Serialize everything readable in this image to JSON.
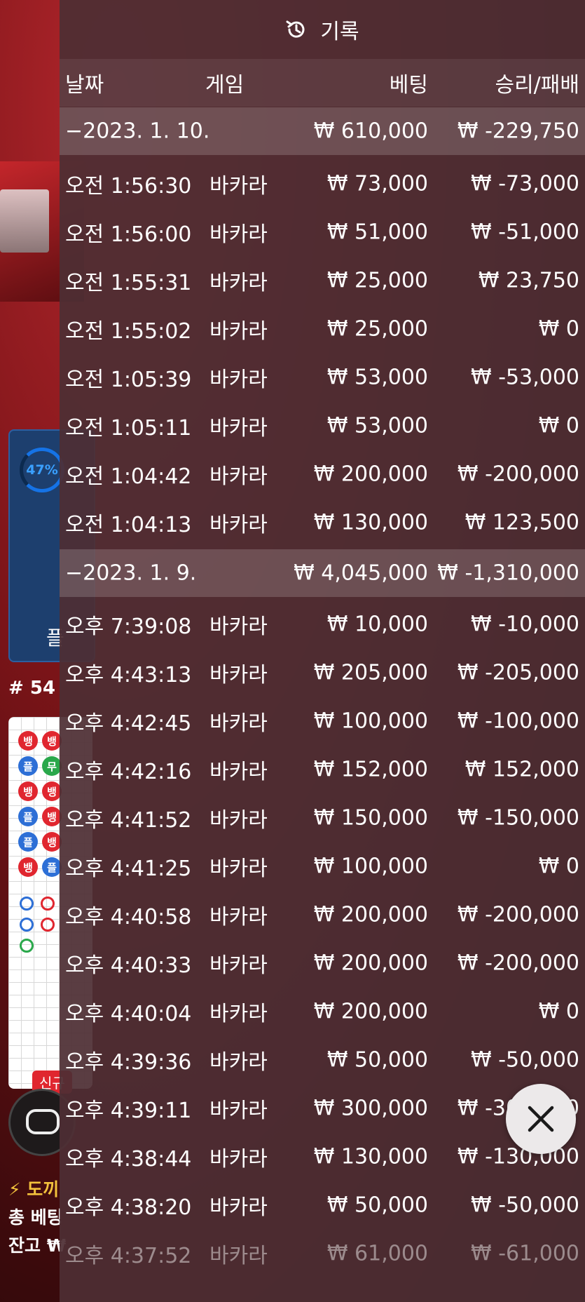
{
  "background": {
    "progress_percent_label": "47%",
    "progress_percent": 47,
    "stats_label": "플",
    "round_number": "# 54",
    "roadmap_labels": [
      "뱅",
      "뱅",
      "플",
      "무",
      "뱅",
      "뱅",
      "플",
      "뱅",
      "플",
      "뱅",
      "뱅",
      "플"
    ],
    "new_badge": "신규",
    "ticker_line": "⚡ 도끼",
    "total_bet_label": "총 베팅",
    "balance_label": "잔고 ₩"
  },
  "history": {
    "title": "기록",
    "columns": {
      "date": "날짜",
      "game": "게임",
      "bet": "베팅",
      "result": "승리/패배"
    },
    "groups": [
      {
        "date": "−2023. 1. 10.",
        "total_bet": "₩ 610,000",
        "total_result": "₩ -229,750",
        "rows": [
          {
            "time": "오전 1:56:30",
            "game": "바카라",
            "bet": "₩ 73,000",
            "result": "₩ -73,000"
          },
          {
            "time": "오전 1:56:00",
            "game": "바카라",
            "bet": "₩ 51,000",
            "result": "₩ -51,000"
          },
          {
            "time": "오전 1:55:31",
            "game": "바카라",
            "bet": "₩ 25,000",
            "result": "₩ 23,750"
          },
          {
            "time": "오전 1:55:02",
            "game": "바카라",
            "bet": "₩ 25,000",
            "result": "₩ 0"
          },
          {
            "time": "오전 1:05:39",
            "game": "바카라",
            "bet": "₩ 53,000",
            "result": "₩ -53,000"
          },
          {
            "time": "오전 1:05:11",
            "game": "바카라",
            "bet": "₩ 53,000",
            "result": "₩ 0"
          },
          {
            "time": "오전 1:04:42",
            "game": "바카라",
            "bet": "₩ 200,000",
            "result": "₩ -200,000"
          },
          {
            "time": "오전 1:04:13",
            "game": "바카라",
            "bet": "₩ 130,000",
            "result": "₩ 123,500"
          }
        ]
      },
      {
        "date": "−2023. 1. 9.",
        "total_bet": "₩ 4,045,000",
        "total_result": "₩ -1,310,000",
        "rows": [
          {
            "time": "오후 7:39:08",
            "game": "바카라",
            "bet": "₩ 10,000",
            "result": "₩ -10,000"
          },
          {
            "time": "오후 4:43:13",
            "game": "바카라",
            "bet": "₩ 205,000",
            "result": "₩ -205,000"
          },
          {
            "time": "오후 4:42:45",
            "game": "바카라",
            "bet": "₩ 100,000",
            "result": "₩ -100,000"
          },
          {
            "time": "오후 4:42:16",
            "game": "바카라",
            "bet": "₩ 152,000",
            "result": "₩ 152,000"
          },
          {
            "time": "오후 4:41:52",
            "game": "바카라",
            "bet": "₩ 150,000",
            "result": "₩ -150,000"
          },
          {
            "time": "오후 4:41:25",
            "game": "바카라",
            "bet": "₩ 100,000",
            "result": "₩ 0"
          },
          {
            "time": "오후 4:40:58",
            "game": "바카라",
            "bet": "₩ 200,000",
            "result": "₩ -200,000"
          },
          {
            "time": "오후 4:40:33",
            "game": "바카라",
            "bet": "₩ 200,000",
            "result": "₩ -200,000"
          },
          {
            "time": "오후 4:40:04",
            "game": "바카라",
            "bet": "₩ 200,000",
            "result": "₩ 0"
          },
          {
            "time": "오후 4:39:36",
            "game": "바카라",
            "bet": "₩ 50,000",
            "result": "₩ -50,000"
          },
          {
            "time": "오후 4:39:11",
            "game": "바카라",
            "bet": "₩ 300,000",
            "result": "₩ -300,000"
          },
          {
            "time": "오후 4:38:44",
            "game": "바카라",
            "bet": "₩ 130,000",
            "result": "₩ -130,000"
          },
          {
            "time": "오후 4:38:20",
            "game": "바카라",
            "bet": "₩ 50,000",
            "result": "₩ -50,000"
          },
          {
            "time": "오후 4:37:52",
            "game": "바카라",
            "bet": "₩ 61,000",
            "result": "₩ -61,000"
          }
        ]
      }
    ],
    "close_icon": "close-icon",
    "history_icon": "history-icon"
  },
  "colors": {
    "panel_bg": "#4e2e34",
    "group_row_bg": "#6f5a5e",
    "road_red": "#e0262f",
    "road_blue": "#2d6fd6",
    "progress_blue": "#1573e6"
  }
}
